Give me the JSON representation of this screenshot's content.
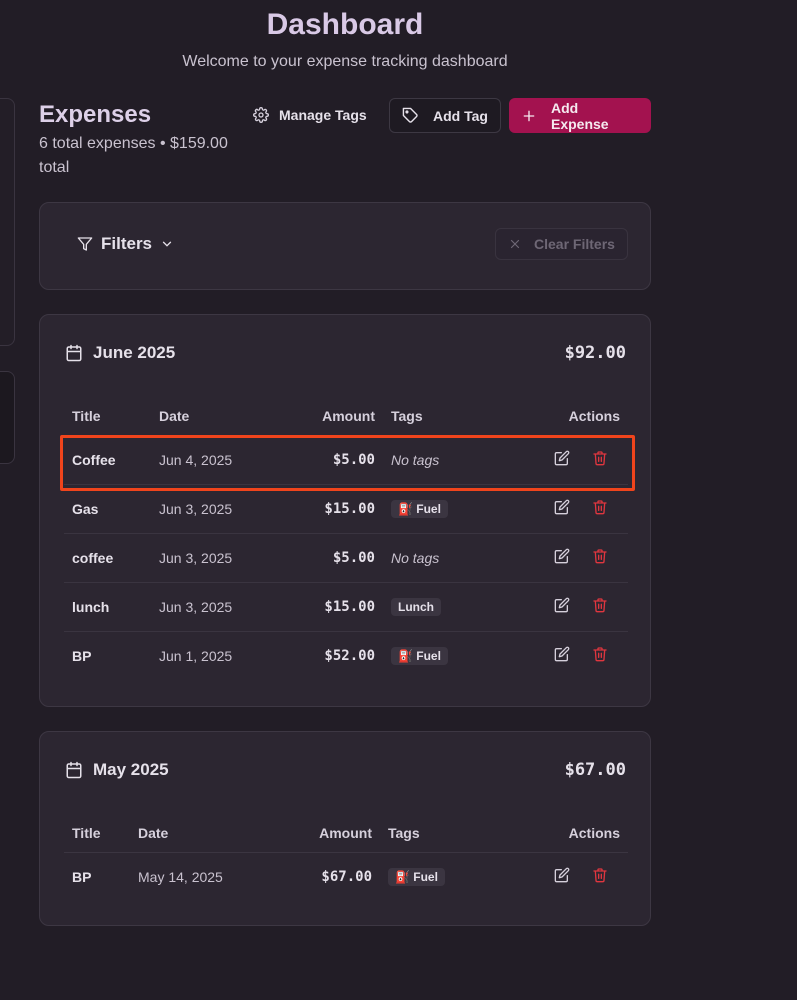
{
  "header": {
    "title": "Dashboard",
    "subtitle": "Welcome to your expense tracking dashboard"
  },
  "expenses": {
    "title": "Expenses",
    "summary": "6 total expenses • $159.00 total"
  },
  "toolbar": {
    "manage_tags_label": "Manage Tags",
    "add_tag_label": "Add Tag",
    "add_expense_label": "Add Expense"
  },
  "filters": {
    "label": "Filters",
    "clear_label": "Clear Filters"
  },
  "columns": {
    "title": "Title",
    "date": "Date",
    "amount": "Amount",
    "tags": "Tags",
    "actions": "Actions"
  },
  "months": [
    {
      "label": "June 2025",
      "total": "$92.00",
      "rows": [
        {
          "title": "Coffee",
          "date": "Jun 4, 2025",
          "amount": "$5.00",
          "tag": "No tags"
        },
        {
          "title": "Gas",
          "date": "Jun 3, 2025",
          "amount": "$15.00",
          "tag": "⛽ Fuel"
        },
        {
          "title": "coffee",
          "date": "Jun 3, 2025",
          "amount": "$5.00",
          "tag": "No tags"
        },
        {
          "title": "lunch",
          "date": "Jun 3, 2025",
          "amount": "$15.00",
          "tag": "Lunch"
        },
        {
          "title": "BP",
          "date": "Jun 1, 2025",
          "amount": "$52.00",
          "tag": "⛽ Fuel"
        }
      ]
    },
    {
      "label": "May 2025",
      "total": "$67.00",
      "rows": [
        {
          "title": "BP",
          "date": "May 14, 2025",
          "amount": "$67.00",
          "tag": "⛽ Fuel"
        }
      ]
    }
  ],
  "colors": {
    "background": "#221d26",
    "card": "#2c2631",
    "accent": "#a3124f",
    "delete": "#e0363f",
    "highlight": "#f0441c"
  }
}
